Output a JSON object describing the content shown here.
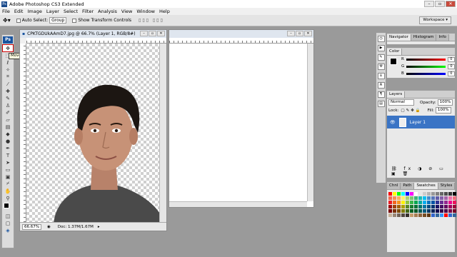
{
  "app": {
    "title": "Adobe Photoshop CS3 Extended",
    "badge": "Ps"
  },
  "menu": [
    "File",
    "Edit",
    "Image",
    "Layer",
    "Select",
    "Filter",
    "Analysis",
    "View",
    "Window",
    "Help"
  ],
  "options": {
    "auto_select_label": "Auto Select:",
    "auto_select_value": "Group",
    "transform_label": "Show Transform Controls",
    "workspace_label": "Workspace ▾"
  },
  "toolbox": {
    "logo": "Ps",
    "tooltip": "Move Tool (V)"
  },
  "document": {
    "title": "CPKTGDUkAAmD7.jpg @ 66.7% (Layer 1, RGB/8#)",
    "zoom": "66.67%",
    "doc_info": "Doc: 1.37M/1.67M"
  },
  "panels": {
    "navigator_tabs": [
      "Navigator",
      "Histogram",
      "Info"
    ],
    "color_tabs": [
      "Color"
    ],
    "color_values": {
      "r": "0",
      "g": "0",
      "b": "0"
    },
    "color_labels": {
      "r": "R",
      "g": "G",
      "b": "B"
    },
    "layers_tabs": [
      "Layers"
    ],
    "blend_mode": "Normal",
    "opacity_label": "Opacity:",
    "opacity_value": "100%",
    "lock_label": "Lock:",
    "fill_label": "Fill:",
    "fill_value": "100%",
    "layer_name": "Layer 1",
    "swatch_tabs": [
      "Chnl",
      "Path",
      "Swatches",
      "Styles"
    ],
    "swatch_colors": [
      "#ff0000",
      "#ffff00",
      "#00ff00",
      "#00ffff",
      "#0000ff",
      "#ff00ff",
      "#ffffff",
      "#e6e6e6",
      "#cccccc",
      "#b3b3b3",
      "#999999",
      "#808080",
      "#666666",
      "#4d4d4d",
      "#333333",
      "#000000",
      "#f26c4f",
      "#f68e55",
      "#fbaf5c",
      "#fff467",
      "#acd372",
      "#7dc473",
      "#3cb878",
      "#1cbbb4",
      "#00bff3",
      "#438ccb",
      "#5574b9",
      "#605ca8",
      "#855fa8",
      "#a763a8",
      "#f06ea9",
      "#f26d7d",
      "#ed1c24",
      "#f26522",
      "#f7941d",
      "#fff200",
      "#8dc63f",
      "#39b54a",
      "#00a651",
      "#00a99d",
      "#00aeef",
      "#0072bc",
      "#0054a6",
      "#2e3192",
      "#662d91",
      "#92278f",
      "#ec008c",
      "#ed145b",
      "#9e0b0f",
      "#a0410d",
      "#a36209",
      "#aba000",
      "#598527",
      "#1a7b30",
      "#007236",
      "#00746b",
      "#0076a3",
      "#004b80",
      "#003471",
      "#1b1464",
      "#440e62",
      "#630460",
      "#9e005d",
      "#9e0039",
      "#790000",
      "#7b2e00",
      "#7d4900",
      "#827b00",
      "#406618",
      "#005e20",
      "#005826",
      "#005952",
      "#005b7f",
      "#003663",
      "#002157",
      "#0d004c",
      "#32004b",
      "#4b0049",
      "#7b0046",
      "#7a0026",
      "#c7b299",
      "#998675",
      "#736357",
      "#534741",
      "#37302d",
      "#c69c6d",
      "#a67c52",
      "#8c6239",
      "#754c24",
      "#603913",
      "#3366cc",
      "#336699",
      "#3399ff",
      "#ff0000",
      "#3366cc",
      "#336699"
    ]
  }
}
